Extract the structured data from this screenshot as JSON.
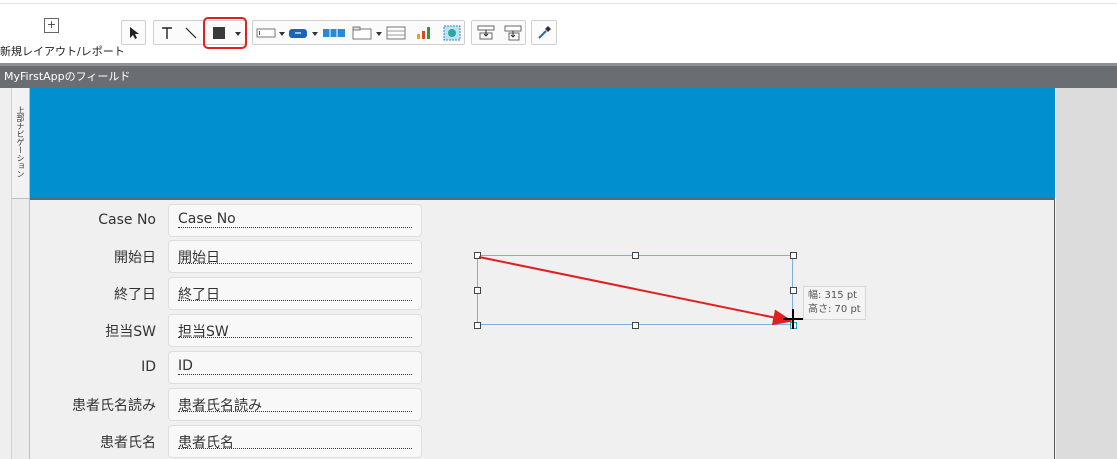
{
  "toolbar": {
    "new_layout_label": "新規レイアウト/レポート",
    "new_layout_icon": "plus-square-icon",
    "tools": [
      {
        "name": "pointer-tool",
        "icon": "arrow-pointer-icon"
      },
      {
        "name": "text-tool",
        "icon": "text-t-icon"
      },
      {
        "name": "line-tool",
        "icon": "line-icon"
      },
      {
        "name": "rectangle-tool",
        "icon": "filled-rectangle-icon",
        "selected": true
      },
      {
        "name": "field-tool",
        "icon": "field-icon"
      },
      {
        "name": "button-tool",
        "icon": "button-icon"
      },
      {
        "name": "button-bar-tool",
        "icon": "button-bar-icon"
      },
      {
        "name": "tab-control-tool",
        "icon": "tab-control-icon"
      },
      {
        "name": "portal-tool",
        "icon": "portal-icon"
      },
      {
        "name": "chart-tool",
        "icon": "chart-icon"
      },
      {
        "name": "web-viewer-tool",
        "icon": "web-viewer-icon"
      },
      {
        "name": "popover-tool",
        "icon": "popover-icon"
      },
      {
        "name": "slide-control-tool",
        "icon": "slide-control-icon"
      },
      {
        "name": "format-painter-tool",
        "icon": "eyedropper-icon"
      }
    ]
  },
  "window": {
    "title": "MyFirstAppのフィールド"
  },
  "layout": {
    "header_part_label": "上部ナビゲーション",
    "header_color": "#0090d0",
    "fields": [
      {
        "label": "Case No",
        "value": "Case No"
      },
      {
        "label": "開始日",
        "value": "開始日"
      },
      {
        "label": "終了日",
        "value": "終了日"
      },
      {
        "label": "担当SW",
        "value": "担当SW"
      },
      {
        "label": "ID",
        "value": "ID"
      },
      {
        "label": "患者氏名読み",
        "value": "患者氏名読み"
      },
      {
        "label": "患者氏名",
        "value": "患者氏名"
      }
    ]
  },
  "drawing": {
    "width_text": "幅: 315 pt",
    "height_text": "高さ: 70 pt",
    "arrow_color": "#e02020",
    "selection_color": "#7eaee8"
  },
  "colors": {
    "highlight": "#e02020"
  }
}
